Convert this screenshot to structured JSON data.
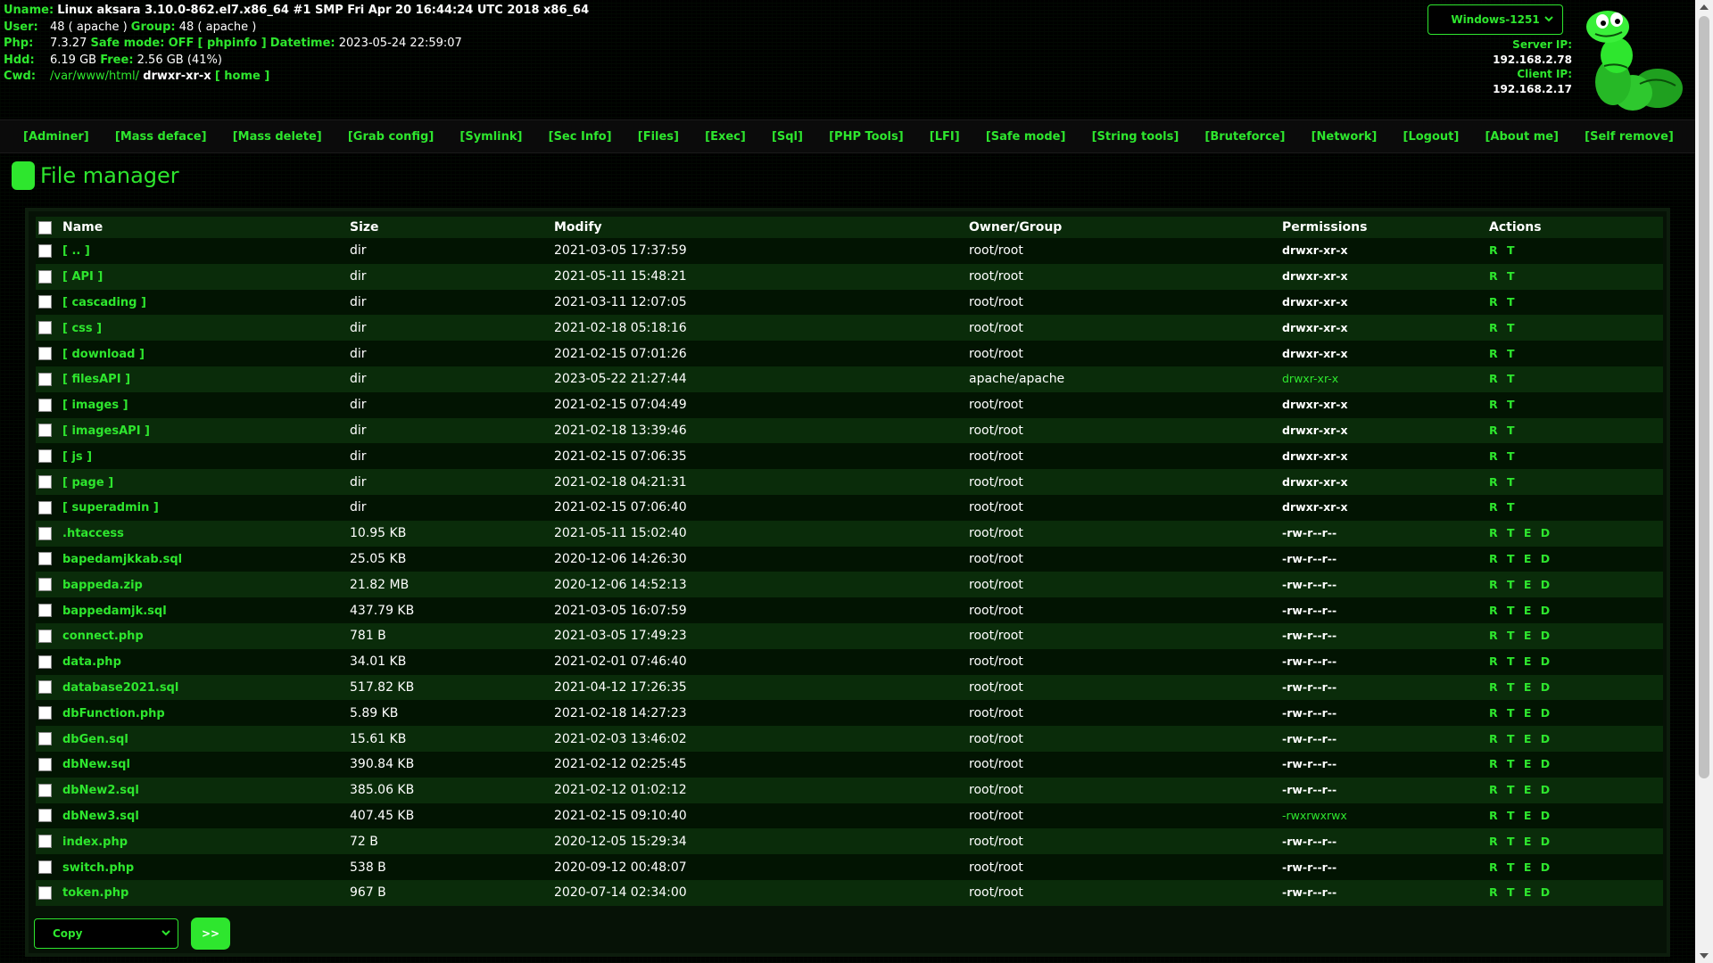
{
  "header": {
    "uname_label": "Uname:",
    "uname": "Linux aksara 3.10.0-862.el7.x86_64 #1 SMP Fri Apr 20 16:44:24 UTC 2018 x86_64",
    "user_label": "User:",
    "user": "48 ( apache )",
    "group_label": "Group:",
    "group": "48 ( apache )",
    "php_label": "Php:",
    "php": "7.3.27",
    "safemode_label": "Safe mode:",
    "safemode": "OFF",
    "phpinfo": "[ phpinfo ]",
    "datetime_label": "Datetime:",
    "datetime": "2023-05-24 22:59:07",
    "hdd_label": "Hdd:",
    "hdd": "6.19 GB",
    "free_label": "Free:",
    "free": "2.56 GB (41%)",
    "cwd_label": "Cwd:",
    "cwd_path": "/var/www/html/",
    "cwd_perm": "drwxr-xr-x",
    "home": "[ home ]",
    "charset": "Windows-1251",
    "server_ip_label": "Server IP:",
    "server_ip": "192.168.2.78",
    "client_ip_label": "Client IP:",
    "client_ip": "192.168.2.17",
    "logo_icon": "snake-logo",
    "accent": "#2ee62e"
  },
  "menu": [
    "[Adminer]",
    "[Mass deface]",
    "[Mass delete]",
    "[Grab config]",
    "[Symlink]",
    "[Sec Info]",
    "[Files]",
    "[Exec]",
    "[Sql]",
    "[PHP Tools]",
    "[LFI]",
    "[Safe mode]",
    "[String tools]",
    "[Bruteforce]",
    "[Network]",
    "[Logout]",
    "[About me]",
    "[Self remove]"
  ],
  "title": "File manager",
  "columns": [
    "Name",
    "Size",
    "Modify",
    "Owner/Group",
    "Permissions",
    "Actions"
  ],
  "files": [
    {
      "name": "[ .. ]",
      "size": "dir",
      "modify": "2021-03-05 17:37:59",
      "owner": "root/root",
      "perms": "drwxr-xr-x",
      "perm_green": false,
      "actions": "R T"
    },
    {
      "name": "[ API ]",
      "size": "dir",
      "modify": "2021-05-11 15:48:21",
      "owner": "root/root",
      "perms": "drwxr-xr-x",
      "perm_green": false,
      "actions": "R T"
    },
    {
      "name": "[ cascading ]",
      "size": "dir",
      "modify": "2021-03-11 12:07:05",
      "owner": "root/root",
      "perms": "drwxr-xr-x",
      "perm_green": false,
      "actions": "R T"
    },
    {
      "name": "[ css ]",
      "size": "dir",
      "modify": "2021-02-18 05:18:16",
      "owner": "root/root",
      "perms": "drwxr-xr-x",
      "perm_green": false,
      "actions": "R T"
    },
    {
      "name": "[ download ]",
      "size": "dir",
      "modify": "2021-02-15 07:01:26",
      "owner": "root/root",
      "perms": "drwxr-xr-x",
      "perm_green": false,
      "actions": "R T"
    },
    {
      "name": "[ filesAPI ]",
      "size": "dir",
      "modify": "2023-05-22 21:27:44",
      "owner": "apache/apache",
      "perms": "drwxr-xr-x",
      "perm_green": true,
      "actions": "R T"
    },
    {
      "name": "[ images ]",
      "size": "dir",
      "modify": "2021-02-15 07:04:49",
      "owner": "root/root",
      "perms": "drwxr-xr-x",
      "perm_green": false,
      "actions": "R T"
    },
    {
      "name": "[ imagesAPI ]",
      "size": "dir",
      "modify": "2021-02-18 13:39:46",
      "owner": "root/root",
      "perms": "drwxr-xr-x",
      "perm_green": false,
      "actions": "R T"
    },
    {
      "name": "[ js ]",
      "size": "dir",
      "modify": "2021-02-15 07:06:35",
      "owner": "root/root",
      "perms": "drwxr-xr-x",
      "perm_green": false,
      "actions": "R T"
    },
    {
      "name": "[ page ]",
      "size": "dir",
      "modify": "2021-02-18 04:21:31",
      "owner": "root/root",
      "perms": "drwxr-xr-x",
      "perm_green": false,
      "actions": "R T"
    },
    {
      "name": "[ superadmin ]",
      "size": "dir",
      "modify": "2021-02-15 07:06:40",
      "owner": "root/root",
      "perms": "drwxr-xr-x",
      "perm_green": false,
      "actions": "R T"
    },
    {
      "name": ".htaccess",
      "size": "10.95 KB",
      "modify": "2021-05-11 15:02:40",
      "owner": "root/root",
      "perms": "-rw-r--r--",
      "perm_green": false,
      "actions": "R T E D"
    },
    {
      "name": "bapedamjkkab.sql",
      "size": "25.05 KB",
      "modify": "2020-12-06 14:26:30",
      "owner": "root/root",
      "perms": "-rw-r--r--",
      "perm_green": false,
      "actions": "R T E D"
    },
    {
      "name": "bappeda.zip",
      "size": "21.82 MB",
      "modify": "2020-12-06 14:52:13",
      "owner": "root/root",
      "perms": "-rw-r--r--",
      "perm_green": false,
      "actions": "R T E D"
    },
    {
      "name": "bappedamjk.sql",
      "size": "437.79 KB",
      "modify": "2021-03-05 16:07:59",
      "owner": "root/root",
      "perms": "-rw-r--r--",
      "perm_green": false,
      "actions": "R T E D"
    },
    {
      "name": "connect.php",
      "size": "781 B",
      "modify": "2021-03-05 17:49:23",
      "owner": "root/root",
      "perms": "-rw-r--r--",
      "perm_green": false,
      "actions": "R T E D"
    },
    {
      "name": "data.php",
      "size": "34.01 KB",
      "modify": "2021-02-01 07:46:40",
      "owner": "root/root",
      "perms": "-rw-r--r--",
      "perm_green": false,
      "actions": "R T E D"
    },
    {
      "name": "database2021.sql",
      "size": "517.82 KB",
      "modify": "2021-04-12 17:26:35",
      "owner": "root/root",
      "perms": "-rw-r--r--",
      "perm_green": false,
      "actions": "R T E D"
    },
    {
      "name": "dbFunction.php",
      "size": "5.89 KB",
      "modify": "2021-02-18 14:27:23",
      "owner": "root/root",
      "perms": "-rw-r--r--",
      "perm_green": false,
      "actions": "R T E D"
    },
    {
      "name": "dbGen.sql",
      "size": "15.61 KB",
      "modify": "2021-02-03 13:46:02",
      "owner": "root/root",
      "perms": "-rw-r--r--",
      "perm_green": false,
      "actions": "R T E D"
    },
    {
      "name": "dbNew.sql",
      "size": "390.84 KB",
      "modify": "2021-02-12 02:25:45",
      "owner": "root/root",
      "perms": "-rw-r--r--",
      "perm_green": false,
      "actions": "R T E D"
    },
    {
      "name": "dbNew2.sql",
      "size": "385.06 KB",
      "modify": "2021-02-12 01:02:12",
      "owner": "root/root",
      "perms": "-rw-r--r--",
      "perm_green": false,
      "actions": "R T E D"
    },
    {
      "name": "dbNew3.sql",
      "size": "407.45 KB",
      "modify": "2021-02-15 09:10:40",
      "owner": "root/root",
      "perms": "-rwxrwxrwx",
      "perm_green": true,
      "actions": "R T E D"
    },
    {
      "name": "index.php",
      "size": "72 B",
      "modify": "2020-12-05 15:29:34",
      "owner": "root/root",
      "perms": "-rw-r--r--",
      "perm_green": false,
      "actions": "R T E D"
    },
    {
      "name": "switch.php",
      "size": "538 B",
      "modify": "2020-09-12 00:48:07",
      "owner": "root/root",
      "perms": "-rw-r--r--",
      "perm_green": false,
      "actions": "R T E D"
    },
    {
      "name": "token.php",
      "size": "967 B",
      "modify": "2020-07-14 02:34:00",
      "owner": "root/root",
      "perms": "-rw-r--r--",
      "perm_green": false,
      "actions": "R T E D"
    }
  ],
  "bulk": {
    "action": "Copy",
    "go": ">>"
  }
}
